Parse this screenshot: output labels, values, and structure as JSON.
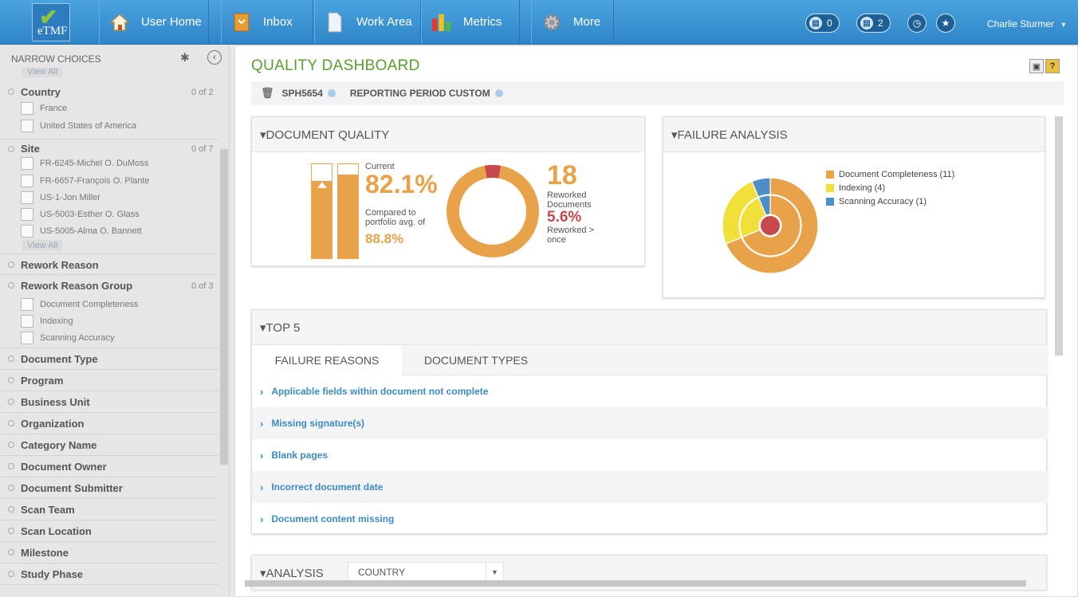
{
  "nav": {
    "logo_text": "eTMF",
    "items": [
      {
        "label": "User Home",
        "icon": "home-icon"
      },
      {
        "label": "Inbox",
        "icon": "inbox-icon"
      },
      {
        "label": "Work Area",
        "icon": "document-icon"
      },
      {
        "label": "Metrics",
        "icon": "bar-chart-icon"
      },
      {
        "label": "More",
        "icon": "gear-icon"
      }
    ],
    "badges": [
      {
        "icon": "clipboard-icon",
        "count": "0"
      },
      {
        "icon": "clipboard-icon",
        "count": "2"
      }
    ],
    "user": "Charlie Sturmer",
    "user_caret": "▾"
  },
  "sidebar": {
    "header": "NARROW CHOICES",
    "top_view_all": "View All",
    "groups": [
      {
        "title": "Country",
        "count": "0 of 2",
        "options": [
          "France",
          "United States of America"
        ]
      },
      {
        "title": "Site",
        "count": "0 of 7",
        "options": [
          "FR-6245-Michel O. DuMoss",
          "FR-6657-François O. Plante",
          "US-1-Jon Miller",
          "US-5003-Esther O. Glass",
          "US-5005-Alma O. Bannett"
        ],
        "view_all": "View All"
      },
      {
        "title": "Rework Reason"
      },
      {
        "title": "Rework Reason Group",
        "count": "0 of 3",
        "options": [
          "Document Completeness",
          "Indexing",
          "Scanning Accuracy"
        ]
      },
      {
        "title": "Document Type"
      },
      {
        "title": "Program"
      },
      {
        "title": "Business Unit"
      },
      {
        "title": "Organization"
      },
      {
        "title": "Category Name"
      },
      {
        "title": "Document Owner"
      },
      {
        "title": "Document Submitter"
      },
      {
        "title": "Scan Team"
      },
      {
        "title": "Scan Location"
      },
      {
        "title": "Milestone"
      },
      {
        "title": "Study Phase"
      }
    ]
  },
  "main": {
    "title": "QUALITY DASHBOARD",
    "filters": [
      "SPH5654",
      "REPORTING PERIOD CUSTOM"
    ],
    "document_quality": {
      "title": "▾DOCUMENT QUALITY",
      "current_label": "Current",
      "current_value": "82.1%",
      "compared_label": "Compared to portfolio avg. of",
      "portfolio_value": "88.8%",
      "current_fraction": 0.821,
      "portfolio_fraction": 0.888,
      "reworked_count": "18",
      "reworked_label": "Reworked Documents",
      "reworked_once_value": "5.6%",
      "reworked_once_label": "Reworked > once",
      "donut_red_fraction": 0.056,
      "colors": {
        "orange": "#e8a24a",
        "red": "#c8494d"
      }
    },
    "failure_analysis": {
      "title": "▾FAILURE ANALYSIS",
      "legend": [
        {
          "label": "Document Completeness (11)",
          "value": 11,
          "color": "#e8a24a"
        },
        {
          "label": "Indexing (4)",
          "value": 4,
          "color": "#f1df3a"
        },
        {
          "label": "Scanning Accuracy (1)",
          "value": 1,
          "color": "#4d8ec9"
        }
      ]
    },
    "top5": {
      "title": "▾TOP 5",
      "tabs": [
        "FAILURE REASONS",
        "DOCUMENT TYPES"
      ],
      "rows": [
        "Applicable fields within document not complete",
        "Missing signature(s)",
        "Blank pages",
        "Incorrect document date",
        "Document content missing"
      ]
    },
    "analysis": {
      "title": "▾ANALYSIS",
      "select_value": "COUNTRY"
    }
  }
}
